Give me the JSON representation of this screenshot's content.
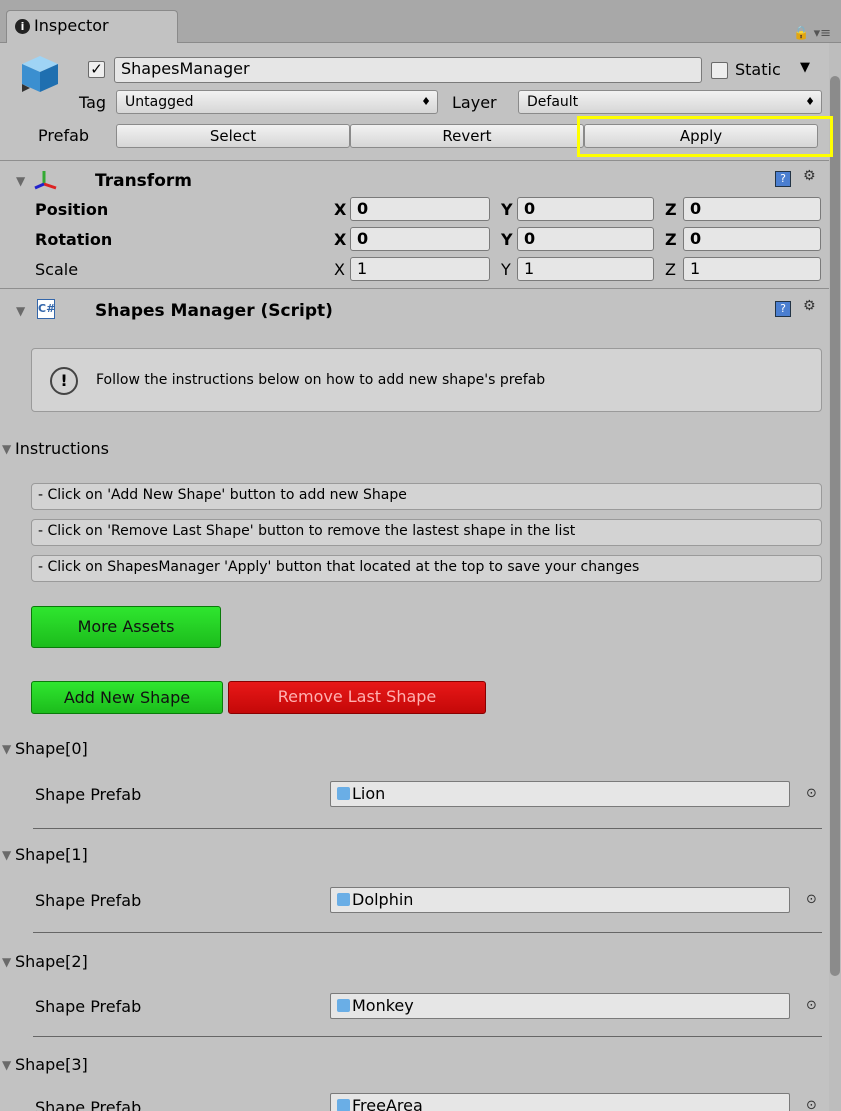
{
  "window": {
    "tab_label": "Inspector",
    "lock_label": "🔒 ▾≡"
  },
  "object": {
    "enabled": true,
    "name": "ShapesManager",
    "static_label": "Static",
    "tag_label": "Tag",
    "tag_value": "Untagged",
    "layer_label": "Layer",
    "layer_value": "Default",
    "prefab_label": "Prefab",
    "prefab_buttons": {
      "select": "Select",
      "revert": "Revert",
      "apply": "Apply"
    },
    "highlight_color": "#ffff00"
  },
  "transform": {
    "title": "Transform",
    "rows": [
      {
        "label": "Position",
        "x": "0",
        "y": "0",
        "z": "0"
      },
      {
        "label": "Rotation",
        "x": "0",
        "y": "0",
        "z": "0"
      },
      {
        "label": "Scale",
        "x": "1",
        "y": "1",
        "z": "1"
      }
    ],
    "axis_labels": {
      "x": "X",
      "y": "Y",
      "z": "Z"
    }
  },
  "script": {
    "title": "Shapes Manager (Script)",
    "help_icon_glyph": "!",
    "help_text": "Follow the instructions below on how to add new shape's prefab",
    "instructions_label": "Instructions",
    "instructions": [
      "- Click on 'Add New Shape' button to add new Shape",
      "- Click on 'Remove Last Shape' button to remove the lastest shape in the list",
      "- Click on ShapesManager 'Apply' button that located at the top to save your changes"
    ],
    "more_assets_label": "More Assets",
    "add_shape_label": "Add New Shape",
    "remove_shape_label": "Remove Last Shape",
    "accent_green": "#22cc22",
    "accent_red": "#d40c0c",
    "shapes": [
      {
        "header": "Shape[0]",
        "field_label": "Shape Prefab",
        "value": "Lion"
      },
      {
        "header": "Shape[1]",
        "field_label": "Shape Prefab",
        "value": "Dolphin"
      },
      {
        "header": "Shape[2]",
        "field_label": "Shape Prefab",
        "value": "Monkey"
      },
      {
        "header": "Shape[3]",
        "field_label": "Shape Prefab",
        "value": "FreeArea"
      }
    ]
  },
  "icons": {
    "foldout": "▼",
    "gear": "⚙",
    "help": "?",
    "object_target": "⊙"
  }
}
